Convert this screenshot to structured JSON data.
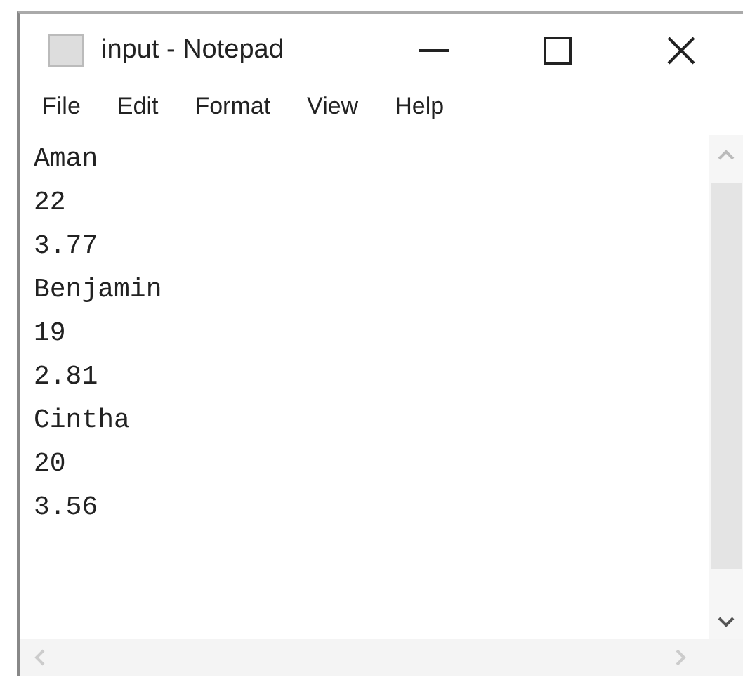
{
  "window": {
    "title": "input - Notepad"
  },
  "menu": [
    "File",
    "Edit",
    "Format",
    "View",
    "Help"
  ],
  "lines": [
    "Aman",
    "22",
    "3.77",
    "Benjamin",
    "19",
    "2.81",
    "Cintha",
    "20",
    "3.56"
  ]
}
